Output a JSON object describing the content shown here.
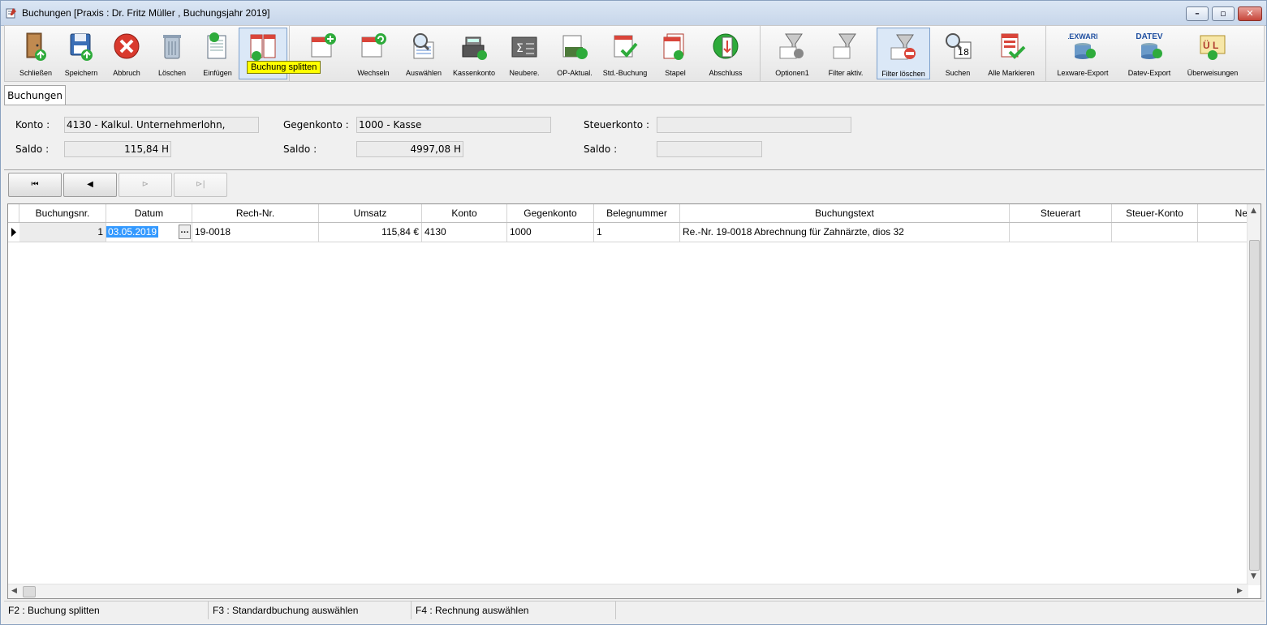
{
  "window": {
    "title": "Buchungen [Praxis : Dr. Fritz Müller , Buchungsjahr 2019]"
  },
  "toolbar": {
    "buttons": [
      {
        "label": "Schließen",
        "icon": "door-exit-icon"
      },
      {
        "label": "Speichern",
        "icon": "floppy-save-icon"
      },
      {
        "label": "Abbruch",
        "icon": "cancel-x-icon"
      },
      {
        "label": "Löschen",
        "icon": "trash-icon"
      },
      {
        "label": "Einfügen",
        "icon": "insert-document-icon"
      },
      {
        "label": "",
        "icon": "split-booking-icon",
        "active": true
      },
      {
        "label": "",
        "icon": "calendar-add-icon"
      },
      {
        "label": "Wechseln",
        "icon": "calendar-switch-icon"
      },
      {
        "label": "Auswählen",
        "icon": "magnifier-select-icon"
      },
      {
        "label": "Kassenkonto",
        "icon": "cash-register-icon"
      },
      {
        "label": "Neubere.",
        "icon": "calculator-sum-icon"
      },
      {
        "label": "OP-Aktual.",
        "icon": "money-update-icon"
      },
      {
        "label": "Std.-Buchung",
        "icon": "standard-booking-icon"
      },
      {
        "label": "Stapel",
        "icon": "stack-icon"
      },
      {
        "label": "Abschluss",
        "icon": "closing-icon"
      },
      {
        "label": "Optionen1",
        "icon": "options-filter-icon"
      },
      {
        "label": "Filter aktiv.",
        "icon": "filter-activate-icon"
      },
      {
        "label": "Filter löschen",
        "icon": "filter-clear-icon",
        "active": true
      },
      {
        "label": "Suchen",
        "icon": "search-calendar-icon"
      },
      {
        "label": "Alle Markieren",
        "icon": "mark-all-icon"
      },
      {
        "label": "Lexware-Export",
        "icon": "lexware-export-icon",
        "text": "LEXWARE"
      },
      {
        "label": "Datev-Export",
        "icon": "datev-export-icon",
        "text": "DATEV"
      },
      {
        "label": "Überweisungen",
        "icon": "transfer-icon",
        "text": "Ü L"
      }
    ],
    "tooltip": "Buchung splitten"
  },
  "tab": {
    "label": "Buchungen"
  },
  "accounts": {
    "konto_label": "Konto :",
    "konto_value": "4130 - Kalkul. Unternehmerlohn,",
    "saldo_label": "Saldo :",
    "konto_saldo": "115,84 H",
    "gegenkonto_label": "Gegenkonto :",
    "gegenkonto_value": "1000 - Kasse",
    "gegenkonto_saldo": "4997,08 H",
    "steuerkonto_label": "Steuerkonto :",
    "steuerkonto_value": "",
    "steuerkonto_saldo": ""
  },
  "nav": {
    "first": "⏮",
    "prev": "◀",
    "next": "⊳",
    "last": "⊳|"
  },
  "grid": {
    "columns": [
      "Buchungsnr.",
      "Datum",
      "Rech-Nr.",
      "Umsatz",
      "Konto",
      "Gegenkonto",
      "Belegnummer",
      "Buchungstext",
      "Steuerart",
      "Steuer-Konto",
      "Ne"
    ],
    "rows": [
      {
        "buchungsnr": "1",
        "datum": "03.05.2019",
        "rechnr": "19-0018",
        "umsatz": "115,84 €",
        "konto": "4130",
        "gegenkonto": "1000",
        "belegnummer": "1",
        "buchungstext": "Re.-Nr. 19-0018 Abrechnung für Zahnärzte, dios 32",
        "steuerart": "",
        "steuerkonto": "",
        "ne": ""
      }
    ]
  },
  "status": {
    "f2": "F2 : Buchung splitten",
    "f3": "F3 : Standardbuchung auswählen",
    "f4": "F4 : Rechnung auswählen"
  },
  "colors": {
    "selection": "#3399ff",
    "tooltip": "#ffff00",
    "accent_blue": "#7ea1cc"
  }
}
